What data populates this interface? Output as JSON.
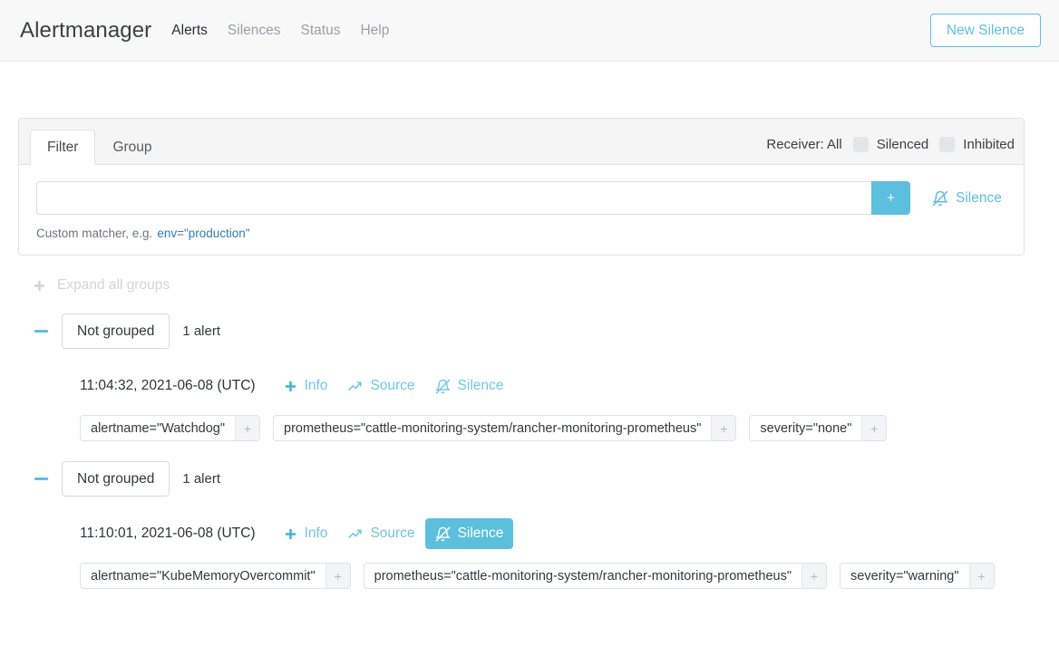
{
  "navbar": {
    "brand": "Alertmanager",
    "links": [
      {
        "label": "Alerts",
        "active": true
      },
      {
        "label": "Silences",
        "active": false
      },
      {
        "label": "Status",
        "active": false
      },
      {
        "label": "Help",
        "active": false
      }
    ],
    "new_silence_button": "New Silence",
    "accent_color": "#5bc0de"
  },
  "filter_card": {
    "tabs": [
      {
        "label": "Filter",
        "active": true
      },
      {
        "label": "Group",
        "active": false
      }
    ],
    "receiver_label": "Receiver: All",
    "checkboxes": [
      {
        "label": "Silenced",
        "checked": false
      },
      {
        "label": "Inhibited",
        "checked": false
      }
    ],
    "input": {
      "value": "",
      "placeholder": ""
    },
    "add_button": "+",
    "silence_link": "Silence",
    "hint_prefix": "Custom matcher, e.g.",
    "hint_example": "env=\"production\""
  },
  "expand_all": {
    "label": "Expand all groups",
    "icon": "plus-icon"
  },
  "groups": [
    {
      "name": "Not grouped",
      "count_label": "1 alert",
      "expanded": true,
      "alerts": [
        {
          "time": "11:04:32, 2021-06-08 (UTC)",
          "actions": [
            {
              "label": "Info",
              "icon": "plus-icon",
              "active": false
            },
            {
              "label": "Source",
              "icon": "chart-line-icon",
              "active": false
            },
            {
              "label": "Silence",
              "icon": "bell-slash-icon",
              "active": false
            }
          ],
          "labels": [
            "alertname=\"Watchdog\"",
            "prometheus=\"cattle-monitoring-system/rancher-monitoring-prometheus\"",
            "severity=\"none\""
          ]
        }
      ]
    },
    {
      "name": "Not grouped",
      "count_label": "1 alert",
      "expanded": true,
      "alerts": [
        {
          "time": "11:10:01, 2021-06-08 (UTC)",
          "actions": [
            {
              "label": "Info",
              "icon": "plus-icon",
              "active": false
            },
            {
              "label": "Source",
              "icon": "chart-line-icon",
              "active": false
            },
            {
              "label": "Silence",
              "icon": "bell-slash-icon",
              "active": true
            }
          ],
          "labels": [
            "alertname=\"KubeMemoryOvercommit\"",
            "prometheus=\"cattle-monitoring-system/rancher-monitoring-prometheus\"",
            "severity=\"warning\""
          ]
        }
      ]
    }
  ],
  "chip_add_label": "+"
}
